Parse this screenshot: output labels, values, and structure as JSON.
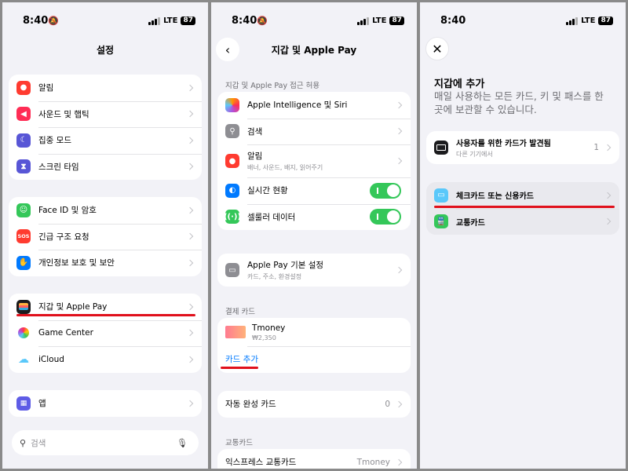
{
  "status": {
    "time": "8:40",
    "network": "LTE",
    "battery": "87"
  },
  "panel1": {
    "title": "설정",
    "group1": [
      {
        "label": "알림",
        "icon": "bell-icon",
        "color": "#ff3b30"
      },
      {
        "label": "사운드 및 햅틱",
        "icon": "speaker-icon",
        "color": "#ff2d55"
      },
      {
        "label": "집중 모드",
        "icon": "moon-icon",
        "color": "#5856d6"
      },
      {
        "label": "스크린 타임",
        "icon": "hourglass-icon",
        "color": "#5856d6"
      }
    ],
    "group2": [
      {
        "label": "Face ID 및 암호",
        "icon": "faceid-icon",
        "color": "#34c759"
      },
      {
        "label": "긴급 구조 요청",
        "icon": "sos-icon",
        "color": "#ff3b30",
        "glyph": "SOS"
      },
      {
        "label": "개인정보 보호 및 보안",
        "icon": "hand-icon",
        "color": "#007aff"
      }
    ],
    "group3": [
      {
        "label": "지갑 및 Apple Pay",
        "icon": "wallet-icon",
        "color": "#1c1c1e"
      },
      {
        "label": "Game Center",
        "icon": "gamecenter-icon",
        "color": "#ffffff"
      },
      {
        "label": "iCloud",
        "icon": "cloud-icon",
        "color": "#ffffff"
      }
    ],
    "group4": [
      {
        "label": "앱",
        "icon": "apps-icon",
        "color": "#5e5ce6"
      }
    ],
    "search_placeholder": "검색"
  },
  "panel2": {
    "title": "지갑 및 Apple Pay",
    "access_header": "지갑 및 Apple Pay 접근 허용",
    "access": [
      {
        "label": "Apple Intelligence 및 Siri",
        "icon": "siri-icon"
      },
      {
        "label": "검색",
        "icon": "search-icon"
      },
      {
        "label": "알림",
        "sub": "배너, 사운드, 배지, 읽어주기",
        "icon": "bell-icon"
      },
      {
        "label": "실시간 현황",
        "icon": "live-activity-icon",
        "toggle": true
      },
      {
        "label": "셀룰러 데이터",
        "icon": "cellular-icon",
        "toggle": true
      }
    ],
    "defaults": {
      "label": "Apple Pay 기본 설정",
      "sub": "카드, 주소, 환경설정"
    },
    "payment_header": "결제 카드",
    "card": {
      "name": "Tmoney",
      "balance": "₩2,350"
    },
    "add_card": "카드 추가",
    "autofill": {
      "label": "자동 완성 카드",
      "value": "0"
    },
    "transit_header": "교통카드",
    "express": {
      "label": "익스프레스 교통카드",
      "value": "Tmoney"
    }
  },
  "panel3": {
    "title": "지갑에 추가",
    "description": "매일 사용하는 모든 카드, 키 및 패스를 한 곳에 보관할 수 있습니다.",
    "found": {
      "label": "사용자를 위한 카드가 발견됨",
      "sub": "다른 기기에서",
      "value": "1"
    },
    "options": [
      {
        "label": "체크카드 또는 신용카드",
        "icon": "creditcard-icon"
      },
      {
        "label": "교통카드",
        "icon": "train-icon"
      }
    ]
  },
  "colors": {
    "highlight": "#e0101b",
    "toggle_on": "#34c759",
    "link": "#007aff"
  }
}
